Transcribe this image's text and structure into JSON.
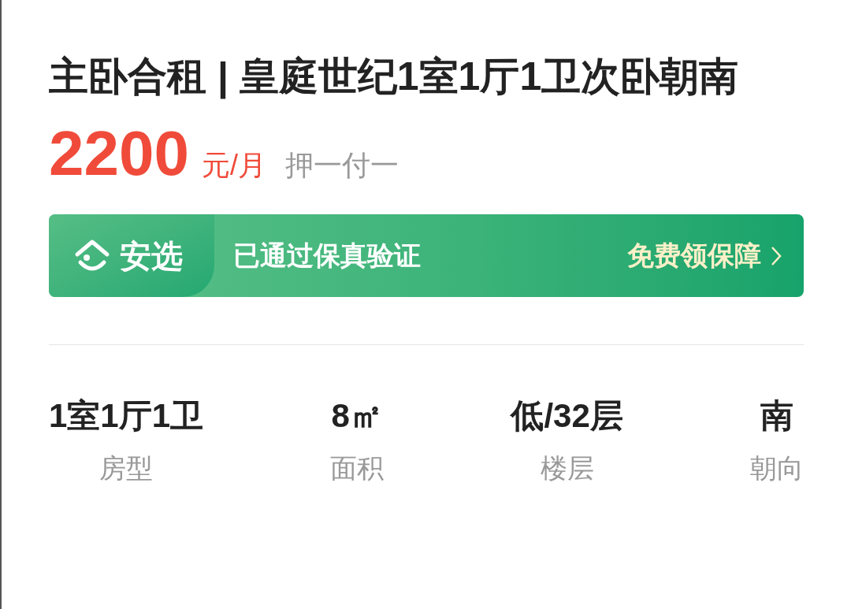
{
  "title": "主卧合租 | 皇庭世纪1室1厅1卫次卧朝南",
  "price": {
    "amount": "2200",
    "unit": "元/月",
    "payment": "押一付一"
  },
  "banner": {
    "brand": "安选",
    "message": "已通过保真验证",
    "action": "免费领保障"
  },
  "stats": [
    {
      "value": "1室1厅1卫",
      "label": "房型"
    },
    {
      "value": "8㎡",
      "label": "面积"
    },
    {
      "value": "低/32层",
      "label": "楼层"
    },
    {
      "value": "南",
      "label": "朝向"
    }
  ]
}
